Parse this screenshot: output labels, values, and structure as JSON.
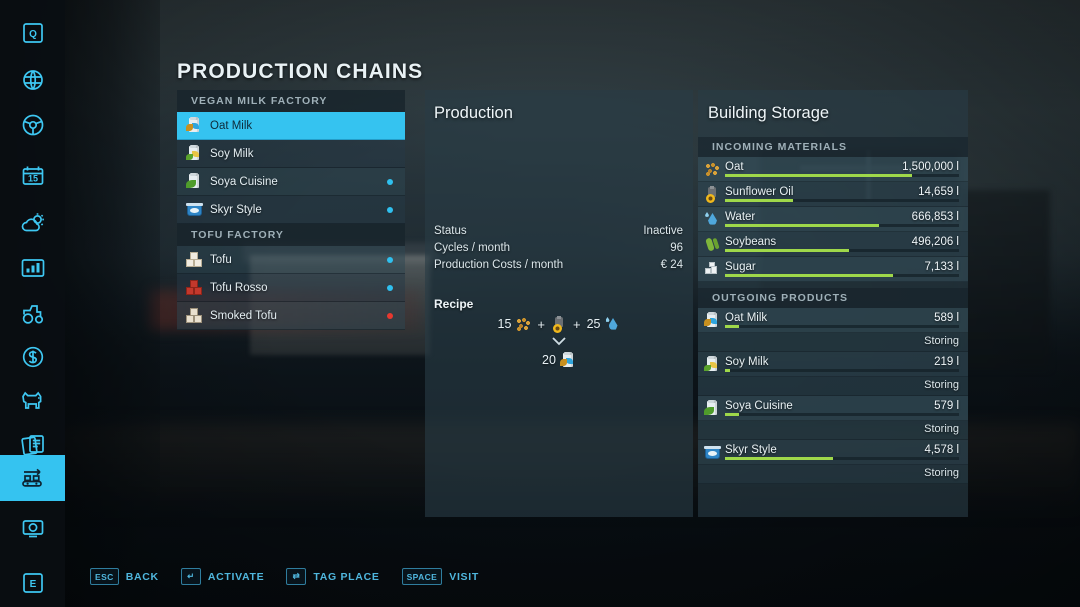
{
  "page_title": "PRODUCTION CHAINS",
  "rail": {
    "items": [
      {
        "name": "quests-icon",
        "label": "Q",
        "active": false
      },
      {
        "name": "map-globe-icon",
        "label": "Map",
        "active": false
      },
      {
        "name": "steering-wheel-icon",
        "label": "Vehicles",
        "active": false
      },
      {
        "name": "calendar-icon",
        "label": "15",
        "active": false
      },
      {
        "name": "weather-icon",
        "label": "Weather",
        "active": false
      },
      {
        "name": "statistics-icon",
        "label": "Statistics",
        "active": false
      },
      {
        "name": "tractor-icon",
        "label": "Machines",
        "active": false
      },
      {
        "name": "finances-icon",
        "label": "Finances",
        "active": false
      },
      {
        "name": "animals-icon",
        "label": "Animals",
        "active": false
      },
      {
        "name": "contracts-icon",
        "label": "Contracts",
        "active": false
      },
      {
        "name": "production-chains-icon",
        "label": "Production",
        "active": true
      },
      {
        "name": "radio-icon",
        "label": "Radio",
        "active": false
      },
      {
        "name": "settings-icon",
        "label": "E",
        "active": false
      }
    ]
  },
  "chain_list": {
    "groups": [
      {
        "header": "VEGAN MILK FACTORY",
        "items": [
          {
            "label": "Oat Milk",
            "icon": "oat-milk-icon",
            "status": "none",
            "selected": true
          },
          {
            "label": "Soy Milk",
            "icon": "soy-milk-icon",
            "status": "none",
            "selected": false
          },
          {
            "label": "Soya Cuisine",
            "icon": "soya-cuisine-icon",
            "status": "blue",
            "selected": false
          },
          {
            "label": "Skyr Style",
            "icon": "skyr-style-icon",
            "status": "blue",
            "selected": false
          }
        ]
      },
      {
        "header": "TOFU FACTORY",
        "items": [
          {
            "label": "Tofu",
            "icon": "tofu-icon",
            "status": "blue",
            "selected": false
          },
          {
            "label": "Tofu Rosso",
            "icon": "tofu-rosso-icon",
            "status": "blue",
            "selected": false
          },
          {
            "label": "Smoked Tofu",
            "icon": "smoked-tofu-icon",
            "status": "red",
            "selected": false
          }
        ]
      }
    ]
  },
  "production": {
    "title": "Production",
    "rows": [
      {
        "label": "Status",
        "value": "Inactive"
      },
      {
        "label": "Cycles / month",
        "value": "96"
      },
      {
        "label": "Production Costs / month",
        "value": "€ 24"
      }
    ],
    "recipe_label": "Recipe",
    "recipe_inputs": [
      {
        "amount": "15",
        "icon": "oat-icon"
      },
      {
        "amount": "",
        "icon": "sunflower-oil-icon"
      },
      {
        "amount": "25",
        "icon": "water-icon"
      }
    ],
    "recipe_output": {
      "amount": "20",
      "icon": "oat-milk-icon"
    }
  },
  "storage": {
    "title": "Building Storage",
    "incoming_header": "INCOMING MATERIALS",
    "incoming": [
      {
        "name": "Oat",
        "icon": "oat-icon",
        "value": "1,500,000 l",
        "fill": 80
      },
      {
        "name": "Sunflower Oil",
        "icon": "sunflower-oil-icon",
        "value": "14,659 l",
        "fill": 29
      },
      {
        "name": "Water",
        "icon": "water-icon",
        "value": "666,853 l",
        "fill": 66
      },
      {
        "name": "Soybeans",
        "icon": "soybeans-icon",
        "value": "496,206 l",
        "fill": 53
      },
      {
        "name": "Sugar",
        "icon": "sugar-icon",
        "value": "7,133 l",
        "fill": 72
      }
    ],
    "outgoing_header": "OUTGOING PRODUCTS",
    "outgoing": [
      {
        "name": "Oat Milk",
        "icon": "oat-milk-icon",
        "value": "589 l",
        "fill": 6,
        "status": "Storing"
      },
      {
        "name": "Soy Milk",
        "icon": "soy-milk-icon",
        "value": "219 l",
        "fill": 2,
        "status": "Storing"
      },
      {
        "name": "Soya Cuisine",
        "icon": "soya-cuisine-icon",
        "value": "579 l",
        "fill": 6,
        "status": "Storing"
      },
      {
        "name": "Skyr Style",
        "icon": "skyr-style-icon",
        "value": "4,578 l",
        "fill": 46,
        "status": "Storing"
      }
    ]
  },
  "helpbar": [
    {
      "key": "ESC",
      "label": "BACK",
      "wide": false
    },
    {
      "key": "↵",
      "label": "ACTIVATE",
      "wide": false
    },
    {
      "key": "⇄",
      "label": "TAG PLACE",
      "wide": false
    },
    {
      "key": "SPACE",
      "label": "VISIT",
      "wide": true
    }
  ],
  "colors": {
    "accent": "#35c3f0",
    "bar_fill": "#9fd84a",
    "status_blue": "#2fc0ef",
    "status_red": "#e8382f",
    "panel_bg": "#2a3c46"
  }
}
